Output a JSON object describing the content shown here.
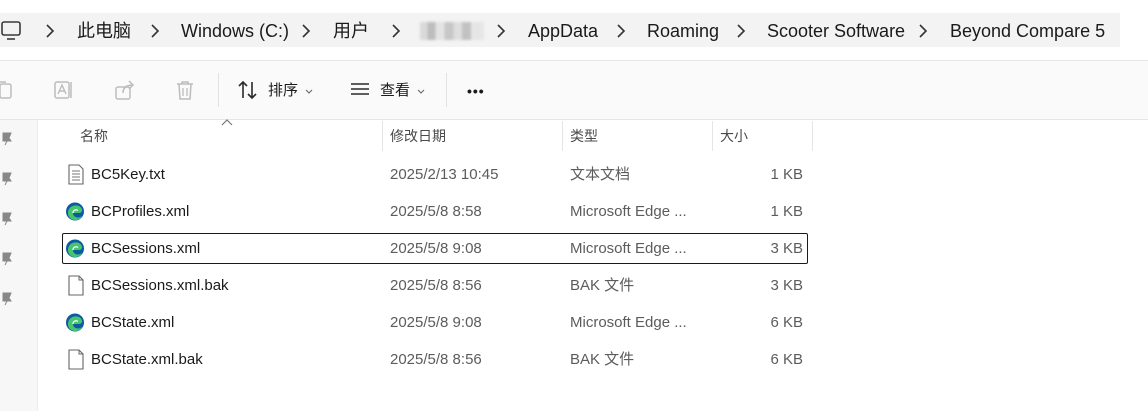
{
  "breadcrumb": {
    "items": [
      "此电脑",
      "Windows (C:)",
      "用户",
      "AppData",
      "Roaming",
      "Scooter Software",
      "Beyond Compare 5"
    ]
  },
  "toolbar": {
    "sort_label": "排序",
    "view_label": "查看",
    "more_label": "•••"
  },
  "columns": {
    "name": "名称",
    "date": "修改日期",
    "type": "类型",
    "size": "大小"
  },
  "files": [
    {
      "name": "BC5Key.txt",
      "date": "2025/2/13 10:45",
      "type": "文本文档",
      "size": "1 KB",
      "icon": "text-file-icon"
    },
    {
      "name": "BCProfiles.xml",
      "date": "2025/5/8 8:58",
      "type": "Microsoft Edge ...",
      "size": "1 KB",
      "icon": "edge-icon"
    },
    {
      "name": "BCSessions.xml",
      "date": "2025/5/8 9:08",
      "type": "Microsoft Edge ...",
      "size": "3 KB",
      "icon": "edge-icon",
      "selected": true
    },
    {
      "name": "BCSessions.xml.bak",
      "date": "2025/5/8 8:56",
      "type": "BAK 文件",
      "size": "3 KB",
      "icon": "blank-file-icon"
    },
    {
      "name": "BCState.xml",
      "date": "2025/5/8 9:08",
      "type": "Microsoft Edge ...",
      "size": "6 KB",
      "icon": "edge-icon"
    },
    {
      "name": "BCState.xml.bak",
      "date": "2025/5/8 8:56",
      "type": "BAK 文件",
      "size": "6 KB",
      "icon": "blank-file-icon"
    }
  ],
  "colors": {
    "edge_blue": "#0c59a4",
    "edge_green": "#47c46d",
    "selection_border": "#1a1a1a"
  }
}
